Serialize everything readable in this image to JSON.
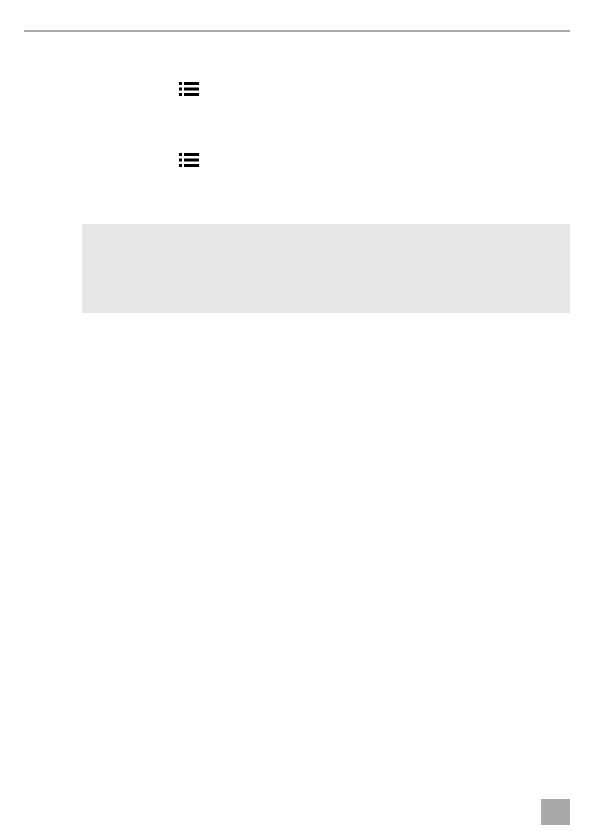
{
  "page": {
    "background_color": "#ffffff"
  },
  "header": {
    "rule_color": "#a9a9a9"
  },
  "content": {
    "items": [
      {
        "icon": "list-icon"
      },
      {
        "icon": "list-icon"
      }
    ],
    "note_box": {
      "background_color": "#e6e6e6"
    }
  },
  "footer": {
    "page_tab_color": "#a9a9a9"
  }
}
